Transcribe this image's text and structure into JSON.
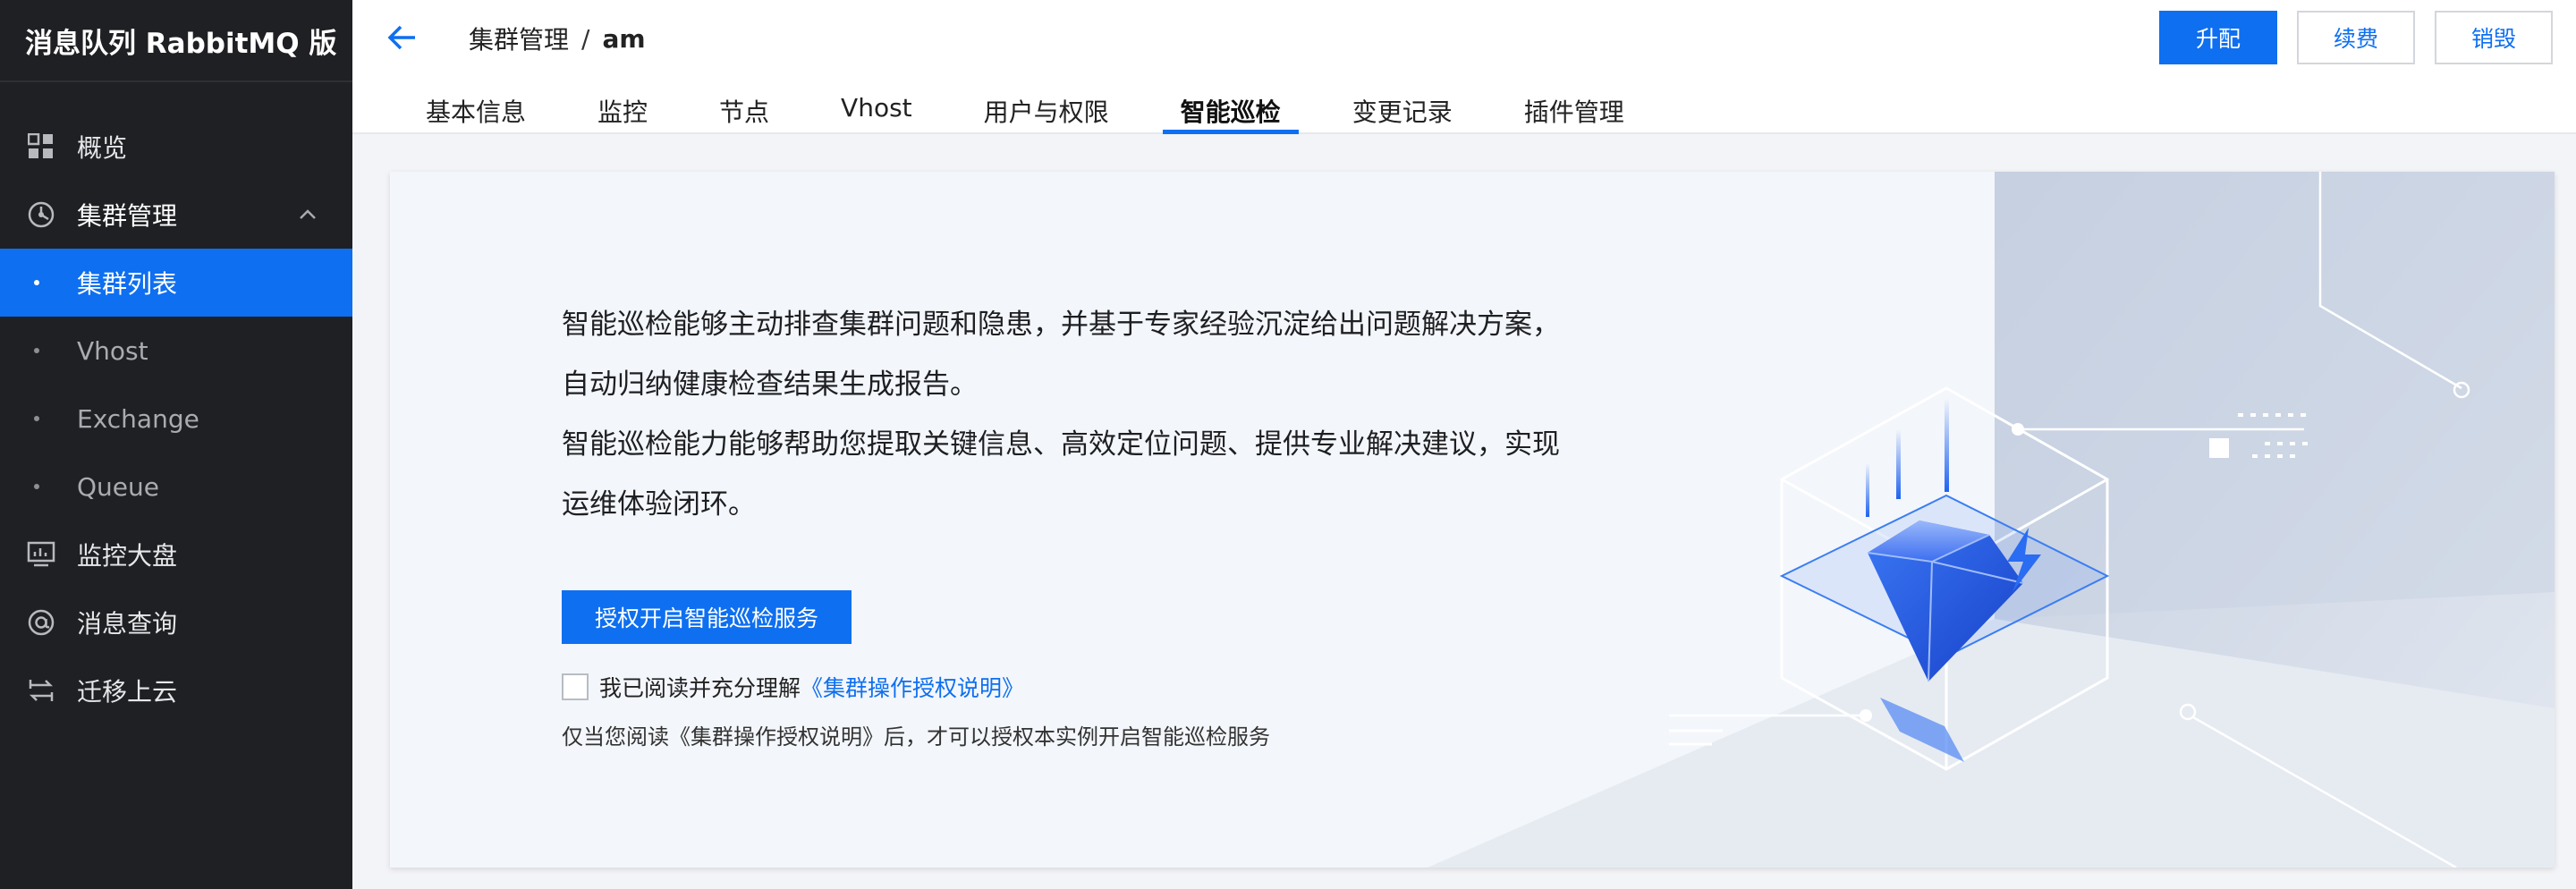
{
  "sidebar": {
    "title": "消息队列 RabbitMQ 版",
    "items": [
      {
        "label": "概览",
        "icon": "grid-icon"
      },
      {
        "label": "集群管理",
        "icon": "cluster-icon"
      },
      {
        "label": "监控大盘",
        "icon": "monitor-icon"
      },
      {
        "label": "消息查询",
        "icon": "at-icon"
      },
      {
        "label": "迁移上云",
        "icon": "migrate-icon"
      }
    ],
    "sub_items": [
      {
        "label": "集群列表",
        "active": true
      },
      {
        "label": "Vhost"
      },
      {
        "label": "Exchange"
      },
      {
        "label": "Queue"
      }
    ]
  },
  "header": {
    "breadcrumb": {
      "section": "集群管理",
      "separator": "/",
      "instance": "am"
    },
    "buttons": {
      "upgrade": "升配",
      "renew": "续费",
      "destroy": "销毁"
    },
    "tabs": [
      {
        "label": "基本信息"
      },
      {
        "label": "监控"
      },
      {
        "label": "节点"
      },
      {
        "label": "Vhost"
      },
      {
        "label": "用户与权限"
      },
      {
        "label": "智能巡检",
        "active": true
      },
      {
        "label": "变更记录"
      },
      {
        "label": "插件管理"
      }
    ]
  },
  "inspection": {
    "desc_lines": [
      "智能巡检能够主动排查集群问题和隐患，并基于专家经验沉淀给出问题解决方案，",
      "自动归纳健康检查结果生成报告。",
      "智能巡检能力能够帮助您提取关键信息、高效定位问题、提供专业解决建议，实现",
      "运维体验闭环。"
    ],
    "auth_button": "授权开启智能巡检服务",
    "agree_text": "我已阅读并充分理解",
    "agree_link": "《集群操作授权说明》",
    "note": "仅当您阅读《集群操作授权说明》后，才可以授权本实例开启智能巡检服务"
  },
  "colors": {
    "primary": "#0e6ff0",
    "sidebar_bg": "#1f2023",
    "card_bg": "#f3f6fa"
  }
}
